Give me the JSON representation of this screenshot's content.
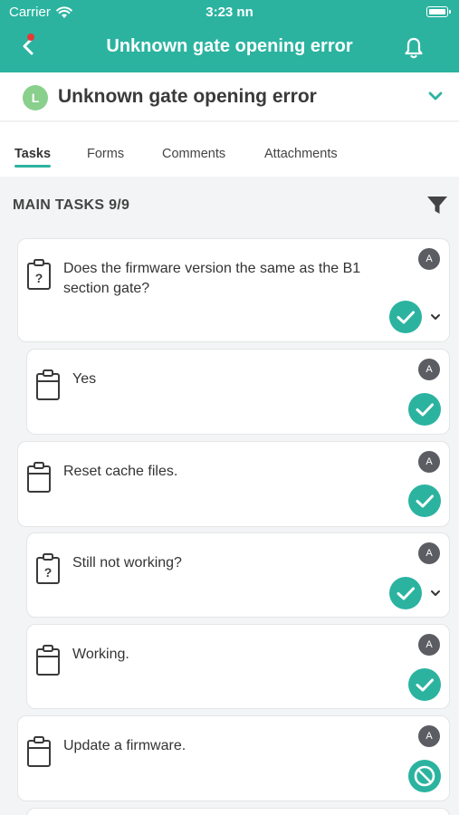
{
  "status_bar": {
    "carrier": "Carrier",
    "time": "3:23 nn"
  },
  "nav": {
    "title": "Unknown gate opening error"
  },
  "header": {
    "avatar_letter": "L",
    "title": "Unknown gate opening error"
  },
  "tabs": [
    {
      "label": "Tasks",
      "active": true
    },
    {
      "label": "Forms",
      "active": false
    },
    {
      "label": "Comments",
      "active": false
    },
    {
      "label": "Attachments",
      "active": false
    }
  ],
  "section": {
    "title": "MAIN TASKS 9/9"
  },
  "tasks": [
    {
      "text": "Does the firmware version the same as the B1 section gate?",
      "icon": "question-clipboard-icon",
      "assignee": "A",
      "status": "done",
      "expandable": true
    },
    {
      "text": "Yes",
      "icon": "clipboard-icon",
      "assignee": "A",
      "status": "done",
      "expandable": false
    },
    {
      "text": "Reset cache files.",
      "icon": "clipboard-icon",
      "assignee": "A",
      "status": "done",
      "expandable": false
    },
    {
      "text": "Still not working?",
      "icon": "question-clipboard-icon",
      "assignee": "A",
      "status": "done",
      "expandable": true
    },
    {
      "text": "Working.",
      "icon": "clipboard-icon",
      "assignee": "A",
      "status": "done",
      "expandable": false
    },
    {
      "text": "Update a firmware.",
      "icon": "clipboard-icon",
      "assignee": "A",
      "status": "blocked",
      "expandable": false
    }
  ],
  "colors": {
    "accent": "#2bb3a0",
    "avatar": "#88d08c",
    "badge": "#5b5d63",
    "notification_dot": "#e53935"
  }
}
